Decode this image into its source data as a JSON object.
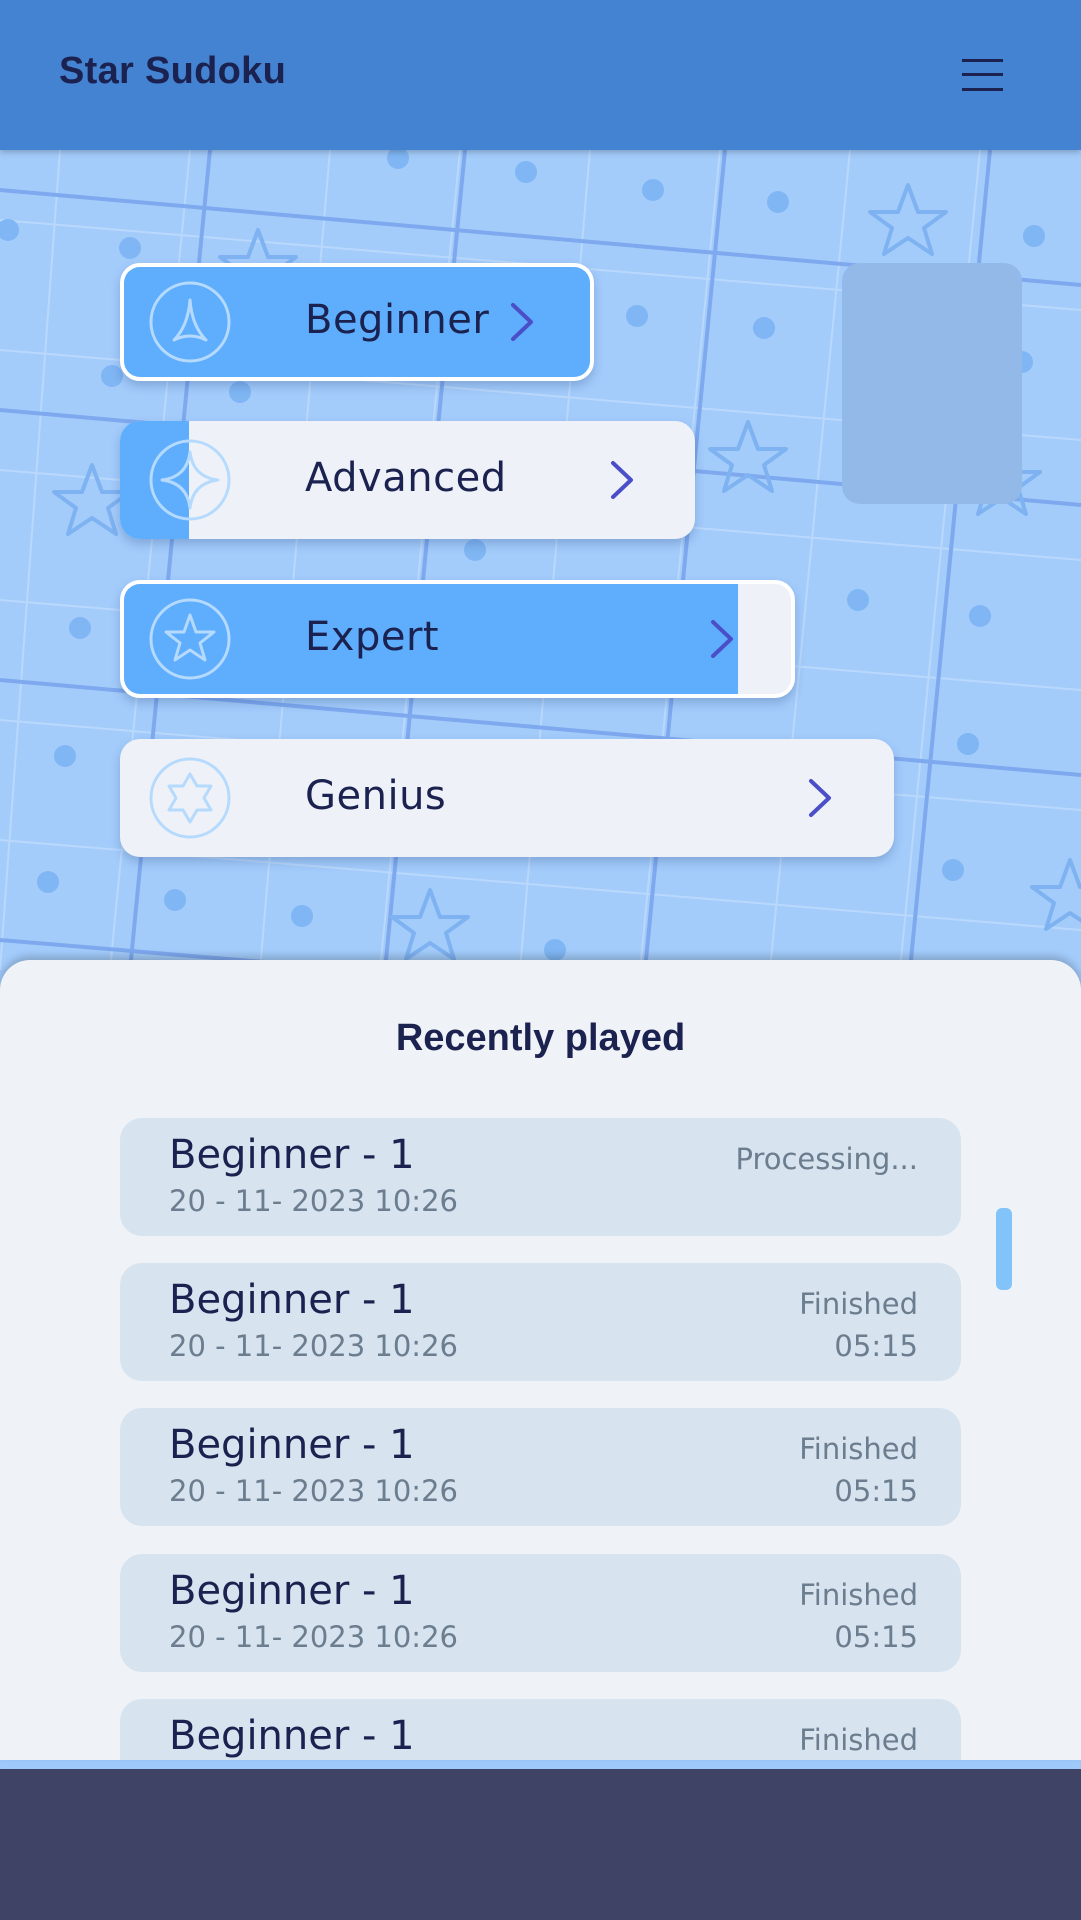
{
  "app": {
    "title": "Star Sudoku"
  },
  "header": {
    "menu_icon": "hamburger-menu-icon"
  },
  "levels": [
    {
      "label": "Beginner",
      "icon": "triangle-star-icon",
      "progress": 1.0,
      "chevron": "chevron-right-icon"
    },
    {
      "label": "Advanced",
      "icon": "four-point-star-icon",
      "progress": 0.12,
      "chevron": "chevron-right-icon"
    },
    {
      "label": "Expert",
      "icon": "five-point-star-icon",
      "progress": 0.92,
      "chevron": "chevron-right-icon"
    },
    {
      "label": "Genius",
      "icon": "six-point-star-icon",
      "progress": 0.0,
      "chevron": "chevron-right-icon"
    }
  ],
  "recent": {
    "title": "Recently played",
    "games": [
      {
        "name": "Beginner - 1",
        "date": "20 - 11- 2023   10:26",
        "status": "Processing...",
        "time": ""
      },
      {
        "name": "Beginner - 1",
        "date": "20 - 11- 2023   10:26",
        "status": "Finished",
        "time": "05:15"
      },
      {
        "name": "Beginner - 1",
        "date": "20 - 11- 2023   10:26",
        "status": "Finished",
        "time": "05:15"
      },
      {
        "name": "Beginner - 1",
        "date": "20 - 11- 2023   10:26",
        "status": "Finished",
        "time": "05:15"
      },
      {
        "name": "Beginner - 1",
        "date": "",
        "status": "Finished",
        "time": ""
      }
    ]
  },
  "colors": {
    "header": "#4383d2",
    "progress_fill": "#5eaefd",
    "button_bg": "#eef2f8",
    "text_dark": "#1b2250",
    "text_muted": "#6b7d8e",
    "chevron": "#4a4fc8",
    "bottom_bar": "#3f4466"
  }
}
